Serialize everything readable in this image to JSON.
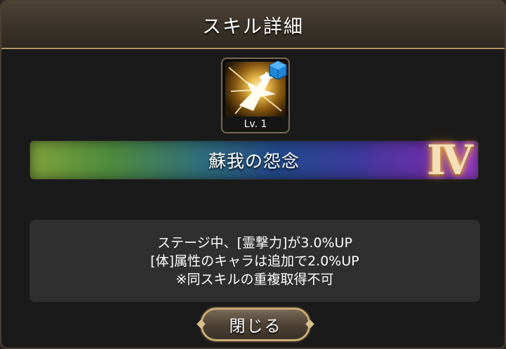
{
  "dialog": {
    "title": "スキル詳細"
  },
  "skill": {
    "icon_name": "winged-star-skill-icon",
    "element_badge_icon": "blue-cube-element-icon",
    "level_label": "Lv. 1",
    "name": "蘇我の怨念",
    "rank": "Ⅳ",
    "description": [
      "ステージ中、[霊撃力]が3.0%UP",
      "[体]属性のキャラは追加で2.0%UP",
      "※同スキルの重複取得不可"
    ]
  },
  "buttons": {
    "close_label": "閉じる"
  },
  "colors": {
    "frame_gold": "#b09566",
    "element_blue": "#1f86d8",
    "rank_glow": "#ffbf55"
  }
}
